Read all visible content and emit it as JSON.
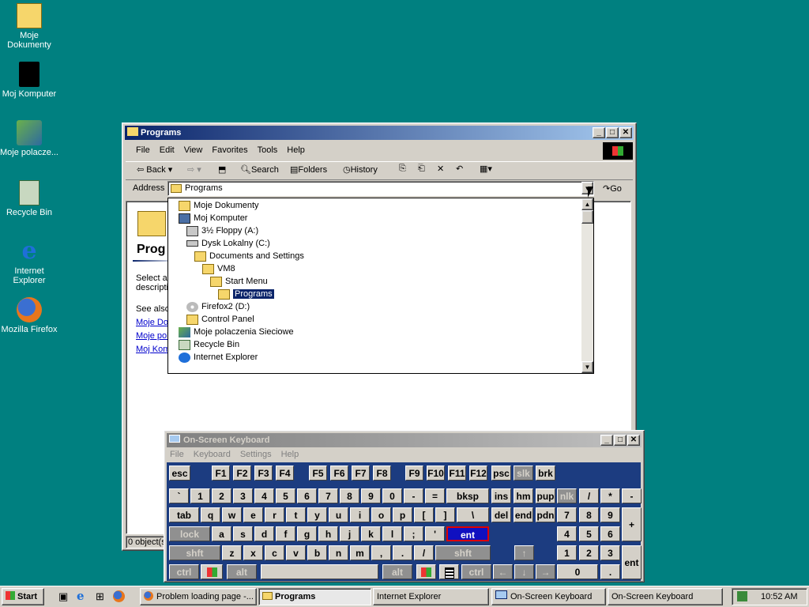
{
  "desktop": {
    "icons": [
      {
        "label": "Moje Dokumenty",
        "icon": "my-documents-icon"
      },
      {
        "label": "Moj Komputer",
        "icon": "my-computer-icon"
      },
      {
        "label": "Moje polacze...",
        "icon": "network-places-icon"
      },
      {
        "label": "Recycle Bin",
        "icon": "recycle-bin-icon"
      },
      {
        "label": "Internet Explorer",
        "icon": "internet-explorer-icon"
      },
      {
        "label": "Mozilla Firefox",
        "icon": "firefox-icon"
      }
    ]
  },
  "explorer": {
    "title": "Programs",
    "menu": [
      "File",
      "Edit",
      "View",
      "Favorites",
      "Tools",
      "Help"
    ],
    "toolbar": {
      "back": "Back",
      "search": "Search",
      "folders": "Folders",
      "history": "History"
    },
    "address_label": "Address",
    "address_value": "Programs",
    "go_label": "Go",
    "left_panel": {
      "heading": "Prog",
      "text1": "Select an",
      "text2": "descripti",
      "see_also": "See also",
      "links": [
        "Moje Dok",
        "Moje pol",
        "Moj Kom"
      ]
    },
    "status": "0 object(s)",
    "dropdown_items": [
      {
        "label": "Moje Dokumenty",
        "icon": "folder"
      },
      {
        "label": "Moj Komputer",
        "icon": "computer"
      },
      {
        "label": "3½ Floppy (A:)",
        "icon": "floppy"
      },
      {
        "label": "Dysk Lokalny (C:)",
        "icon": "drive"
      },
      {
        "label": "Documents and Settings",
        "icon": "folder"
      },
      {
        "label": "VM8",
        "icon": "folder"
      },
      {
        "label": "Start Menu",
        "icon": "folder"
      },
      {
        "label": "Programs",
        "icon": "folder-open",
        "selected": true
      },
      {
        "label": "Firefox2 (D:)",
        "icon": "cdrom"
      },
      {
        "label": "Control Panel",
        "icon": "control-panel"
      },
      {
        "label": "Moje polaczenia Sieciowe",
        "icon": "network"
      },
      {
        "label": "Recycle Bin",
        "icon": "recycle"
      },
      {
        "label": "Internet Explorer",
        "icon": "ie"
      }
    ]
  },
  "osk": {
    "title": "On-Screen Keyboard",
    "menu": [
      "File",
      "Keyboard",
      "Settings",
      "Help"
    ],
    "rows": {
      "fkeys": [
        "esc",
        "F1",
        "F2",
        "F3",
        "F4",
        "F5",
        "F6",
        "F7",
        "F8",
        "F9",
        "F10",
        "F11",
        "F12",
        "psc",
        "slk",
        "brk"
      ],
      "num": [
        "`",
        "1",
        "2",
        "3",
        "4",
        "5",
        "6",
        "7",
        "8",
        "9",
        "0",
        "-",
        "=",
        "bksp",
        "ins",
        "hm",
        "pup",
        "nlk",
        "/",
        "*",
        "-"
      ],
      "q": [
        "tab",
        "q",
        "w",
        "e",
        "r",
        "t",
        "y",
        "u",
        "i",
        "o",
        "p",
        "[",
        "]",
        "\\",
        "del",
        "end",
        "pdn",
        "7",
        "8",
        "9",
        "+"
      ],
      "a": [
        "lock",
        "a",
        "s",
        "d",
        "f",
        "g",
        "h",
        "j",
        "k",
        "l",
        ";",
        "'",
        "ent",
        "4",
        "5",
        "6"
      ],
      "z": [
        "shft",
        "z",
        "x",
        "c",
        "v",
        "b",
        "n",
        "m",
        ",",
        ".",
        "/",
        "shft",
        "↑",
        "1",
        "2",
        "3",
        "ent"
      ],
      "bottom": [
        "ctrl",
        "alt",
        "alt",
        "ctrl",
        "←",
        "↓",
        "→",
        "0",
        "."
      ]
    }
  },
  "taskbar": {
    "start": "Start",
    "tasks": [
      "Problem loading page -...",
      "Programs",
      "Internet Explorer",
      "On-Screen Keyboard",
      "On-Screen Keyboard"
    ],
    "clock": "10:52 AM"
  }
}
